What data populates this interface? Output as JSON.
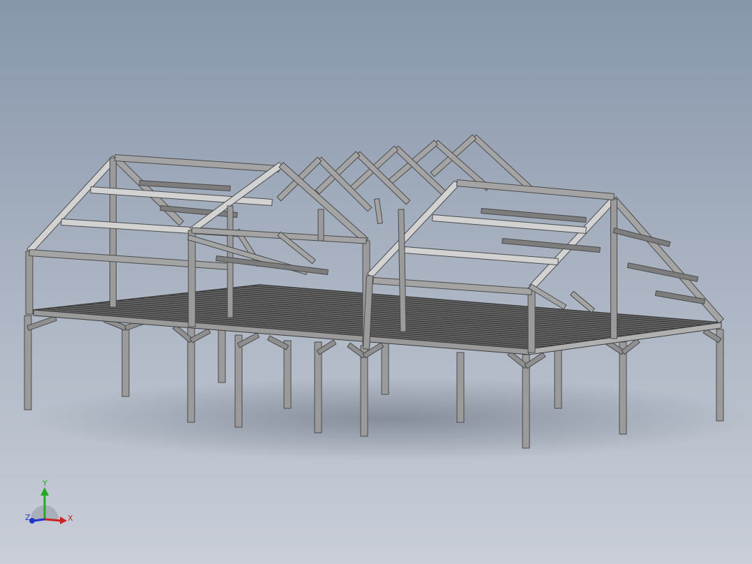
{
  "viewport": {
    "background_top": "#8796ab",
    "background_bottom": "#c9ced8",
    "model_color": "#8c8c8c",
    "edge_color": "#4a4a4a"
  },
  "triad": {
    "x_label": "X",
    "y_label": "Y",
    "z_label": "Z",
    "x_color": "#cc2222",
    "y_color": "#22aa22",
    "z_color": "#2233cc"
  }
}
